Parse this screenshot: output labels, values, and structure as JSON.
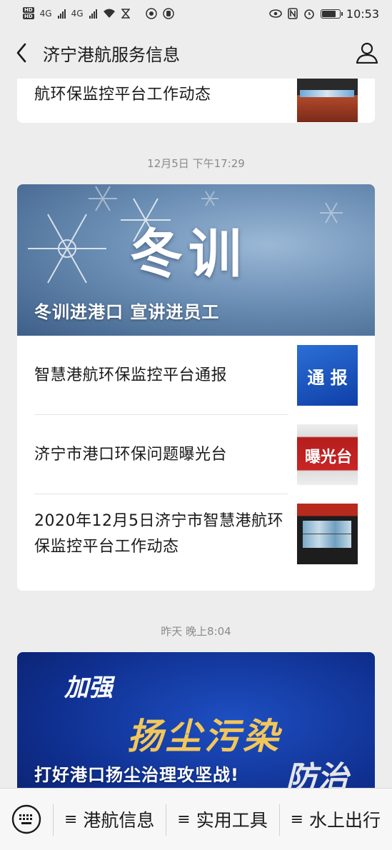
{
  "status_bar": {
    "network_1": "4G",
    "network_2": "4G",
    "time": "10:53"
  },
  "nav": {
    "title": "济宁港航服务信息",
    "back_icon": "chevron-left-icon",
    "profile_icon": "person-icon"
  },
  "feed": {
    "top_partial": {
      "text": "航环保监控平台工作动态"
    },
    "group1": {
      "timestamp": "12月5日 下午17:29",
      "cover_art_text": "冬训",
      "cover_title": "冬训进港口  宣讲进员工",
      "items": [
        {
          "text": "智慧港航环保监控平台通报",
          "thumb_text": "通 报"
        },
        {
          "text": "济宁市港口环保问题曝光台",
          "thumb_text": "曝光台"
        },
        {
          "text": "2020年12月5日济宁市智慧港航环保监控平台工作动态"
        }
      ]
    },
    "group2": {
      "timestamp": "昨天 晚上8:04",
      "cover_art_1": "加强",
      "cover_art_2": "扬尘污染",
      "cover_art_3": "防治",
      "cover_title": "打好港口扬尘治理攻坚战!"
    }
  },
  "bottom_menu": {
    "keyboard_icon": "keyboard-icon",
    "items": [
      {
        "label": "港航信息"
      },
      {
        "label": "实用工具"
      },
      {
        "label": "水上出行"
      }
    ]
  }
}
